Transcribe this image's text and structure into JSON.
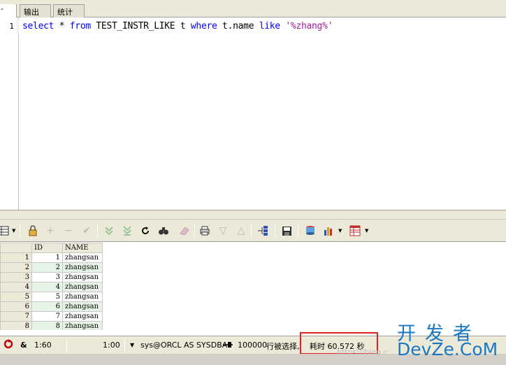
{
  "tabs": {
    "stub": "-",
    "output": "输出",
    "stats": "统计"
  },
  "editor": {
    "line_number": "1",
    "tokens": {
      "select": "select",
      "star": " * ",
      "from": "from",
      "table": " TEST_INSTR_LIKE t ",
      "where": "where",
      "col": " t.name ",
      "like": "like",
      "space": " ",
      "literal": "'%zhang%'"
    }
  },
  "toolbar": {
    "icons": [
      "grid-icon",
      "lock-icon",
      "add-row-icon",
      "delete-row-icon",
      "post-icon",
      "fetch-next-icon",
      "fetch-last-icon",
      "refresh-icon",
      "find-icon",
      "clear-icon",
      "print-icon",
      "filter-down-icon",
      "filter-up-icon",
      "tree-icon",
      "save-icon",
      "export-icon",
      "chart-icon",
      "table-icon"
    ]
  },
  "grid": {
    "headers": [
      "ID",
      "NAME"
    ],
    "rows": [
      {
        "rn": "1",
        "id": "1",
        "name": "zhangsan"
      },
      {
        "rn": "2",
        "id": "2",
        "name": "zhangsan"
      },
      {
        "rn": "3",
        "id": "3",
        "name": "zhangsan"
      },
      {
        "rn": "4",
        "id": "4",
        "name": "zhangsan"
      },
      {
        "rn": "5",
        "id": "5",
        "name": "zhangsan"
      },
      {
        "rn": "6",
        "id": "6",
        "name": "zhangsan"
      },
      {
        "rn": "7",
        "id": "7",
        "name": "zhangsan"
      },
      {
        "rn": "8",
        "id": "8",
        "name": "zhangsan"
      }
    ]
  },
  "status": {
    "amp": "&",
    "pos1": "1:60",
    "pos2": "1:00",
    "connection": "sys@ORCL AS SYSDBA",
    "fetch": "100000",
    "selected": "行被选择,",
    "elapsed": "耗时 60.572 秒"
  },
  "watermark": {
    "url": "https://blog.c",
    "logo_top": "开发者",
    "logo_bottom": "DevZe.CoM"
  },
  "colors": {
    "keyword": "#0000ff",
    "string": "#a020a0",
    "highlight": "#e02020",
    "logo": "#1a78c2"
  }
}
